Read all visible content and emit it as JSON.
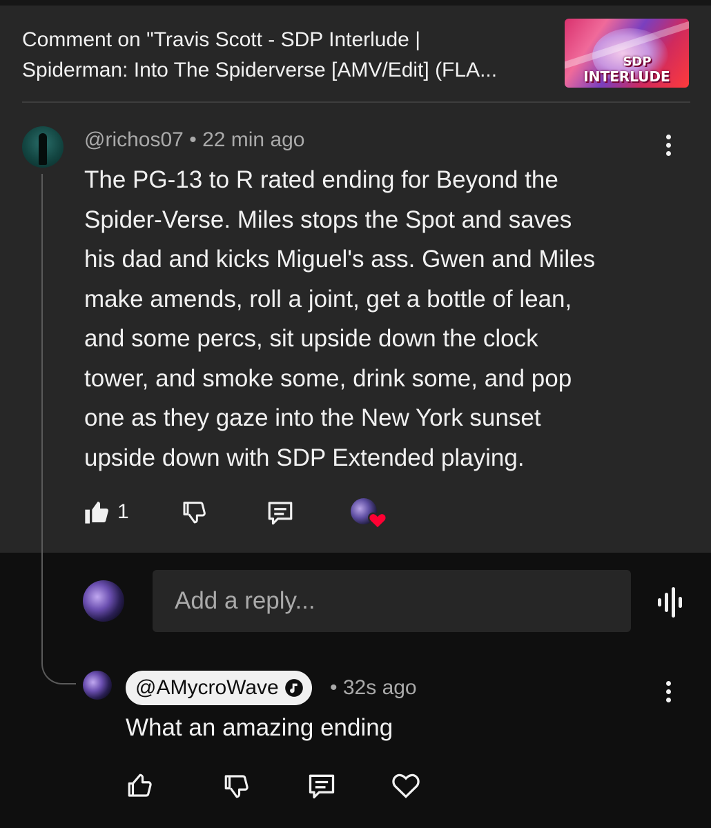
{
  "video": {
    "title_line1": "Comment on \"Travis Scott - SDP Interlude |",
    "title_line2": "Spiderman: Into The Spiderverse [AMV/Edit] (FLA...",
    "thumbnail_text_1": "SDP",
    "thumbnail_text_2": "INTERLUDE"
  },
  "comment": {
    "handle": "@richos07",
    "separator": "•",
    "time": "22 min ago",
    "lines": [
      "The PG-13 to R rated ending for Beyond the",
      "Spider-Verse. Miles stops the Spot and saves",
      "his dad and kicks Miguel's ass. Gwen and Miles",
      "make amends, roll a joint, get a bottle of lean,",
      "and some percs, sit upside down the clock",
      "tower, and smoke some, drink some, and pop",
      "one as they gaze into the New York sunset",
      "upside down with SDP Extended playing."
    ],
    "like_count": "1",
    "icons": {
      "like": "thumbs-up-filled-icon",
      "dislike": "thumbs-down-icon",
      "reply": "reply-comment-icon",
      "hearted": "creator-heart-icon",
      "menu": "more-vert-icon"
    }
  },
  "reply_box": {
    "placeholder": "Add a reply...",
    "voice_icon": "voice-search-icon"
  },
  "reply": {
    "handle": "@AMycroWave",
    "separator": "•",
    "time": "32s ago",
    "text": "What an amazing ending",
    "verified_icon": "music-note-verified-icon"
  },
  "colors": {
    "upper_bg": "#272727",
    "lower_bg": "#0f0f0f",
    "text_primary": "#f1f1f1",
    "text_secondary": "#aaaaaa",
    "heart_red": "#ff0033"
  }
}
